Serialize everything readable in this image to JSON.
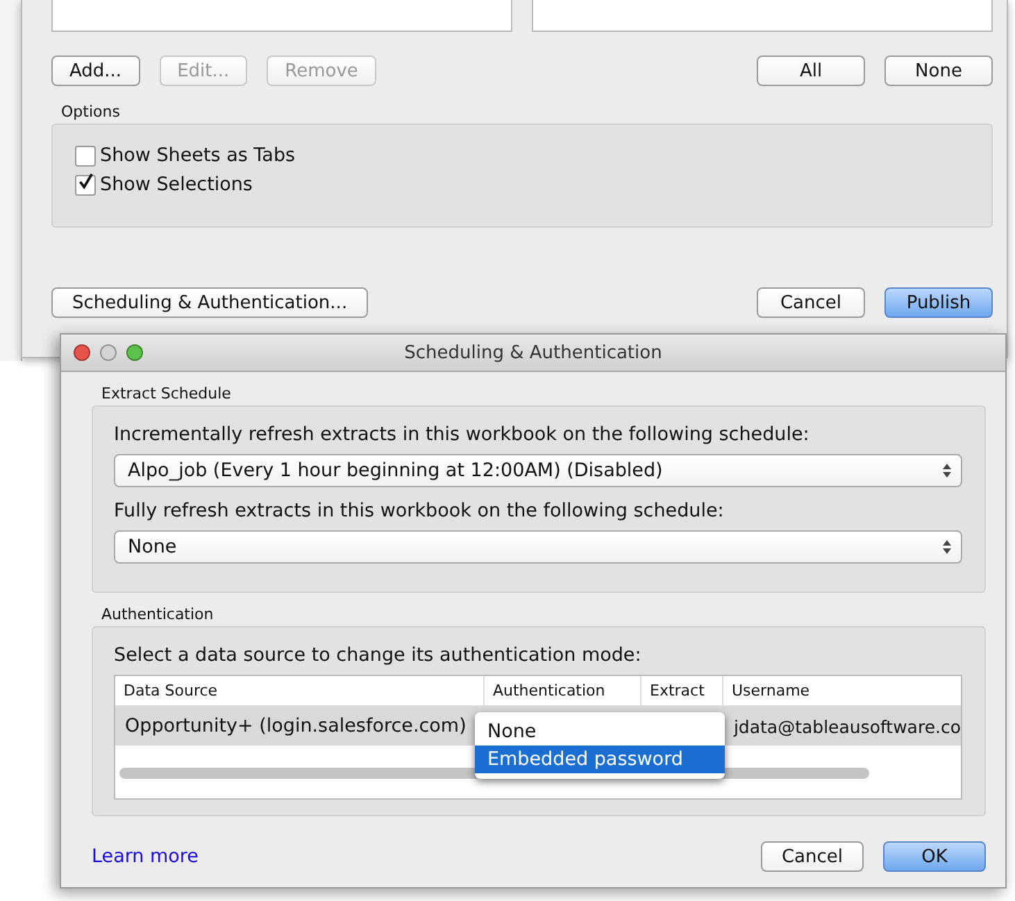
{
  "publish_window": {
    "list_buttons": [
      {
        "label": "Add...",
        "disabled": false
      },
      {
        "label": "Edit...",
        "disabled": true
      },
      {
        "label": "Remove",
        "disabled": true
      }
    ],
    "selection_buttons": [
      "All",
      "None"
    ],
    "options": {
      "title": "Options",
      "items": [
        {
          "label": "Show Sheets as Tabs",
          "checked": false
        },
        {
          "label": "Show Selections",
          "checked": true
        }
      ]
    },
    "scheduling_button": "Scheduling & Authentication...",
    "buttons": [
      {
        "label": "Cancel",
        "default": false
      },
      {
        "label": "Publish",
        "default": true
      }
    ]
  },
  "dialog": {
    "title": "Scheduling & Authentication",
    "extract_schedule": {
      "title": "Extract Schedule",
      "incremental_label": "Incrementally refresh extracts in this workbook on the following schedule:",
      "incremental_value": "Alpo_job (Every 1 hour beginning at 12:00AM) (Disabled)",
      "full_label": "Fully refresh extracts in this workbook on the following schedule:",
      "full_value": "None"
    },
    "authentication": {
      "title": "Authentication",
      "prompt": "Select a data source to change its authentication mode:",
      "table": {
        "columns": [
          "Data Source",
          "Authentication",
          "Extract",
          "Username"
        ],
        "rows": [
          {
            "data_source": "Opportunity+ (login.salesforce.com)",
            "username": "jdata@tableausoftware.co"
          }
        ]
      }
    },
    "menu": {
      "items": [
        {
          "label": "None",
          "selected": false
        },
        {
          "label": "Embedded password",
          "selected": true
        }
      ]
    },
    "learn_more": "Learn more",
    "buttons": [
      {
        "label": "Cancel",
        "default": false
      },
      {
        "label": "OK",
        "default": true
      }
    ]
  }
}
